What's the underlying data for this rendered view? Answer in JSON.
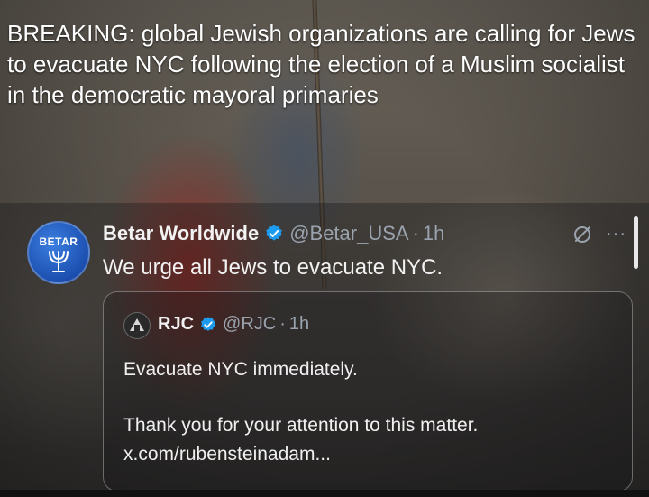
{
  "headline": "BREAKING: global Jewish organizations are calling for Jews to evacuate NYC following the election of a Muslim socialist in the democratic mayoral primaries",
  "tweet": {
    "avatar_text": "BETAR",
    "author_name": "Betar Worldwide",
    "handle": "@Betar_USA",
    "separator": "·",
    "time": "1h",
    "text": "We urge all Jews to evacuate NYC.",
    "more": "···"
  },
  "quote": {
    "author_name": "RJC",
    "handle": "@RJC",
    "separator": "·",
    "time": "1h",
    "line1": "Evacuate NYC immediately.",
    "line2": "Thank you for your attention to this matter.",
    "link": "x.com/rubensteinadam..."
  },
  "colors": {
    "verified": "#1d9bf0",
    "secondary_text": "#9aa3ad",
    "primary_text": "#f2f2f2"
  }
}
